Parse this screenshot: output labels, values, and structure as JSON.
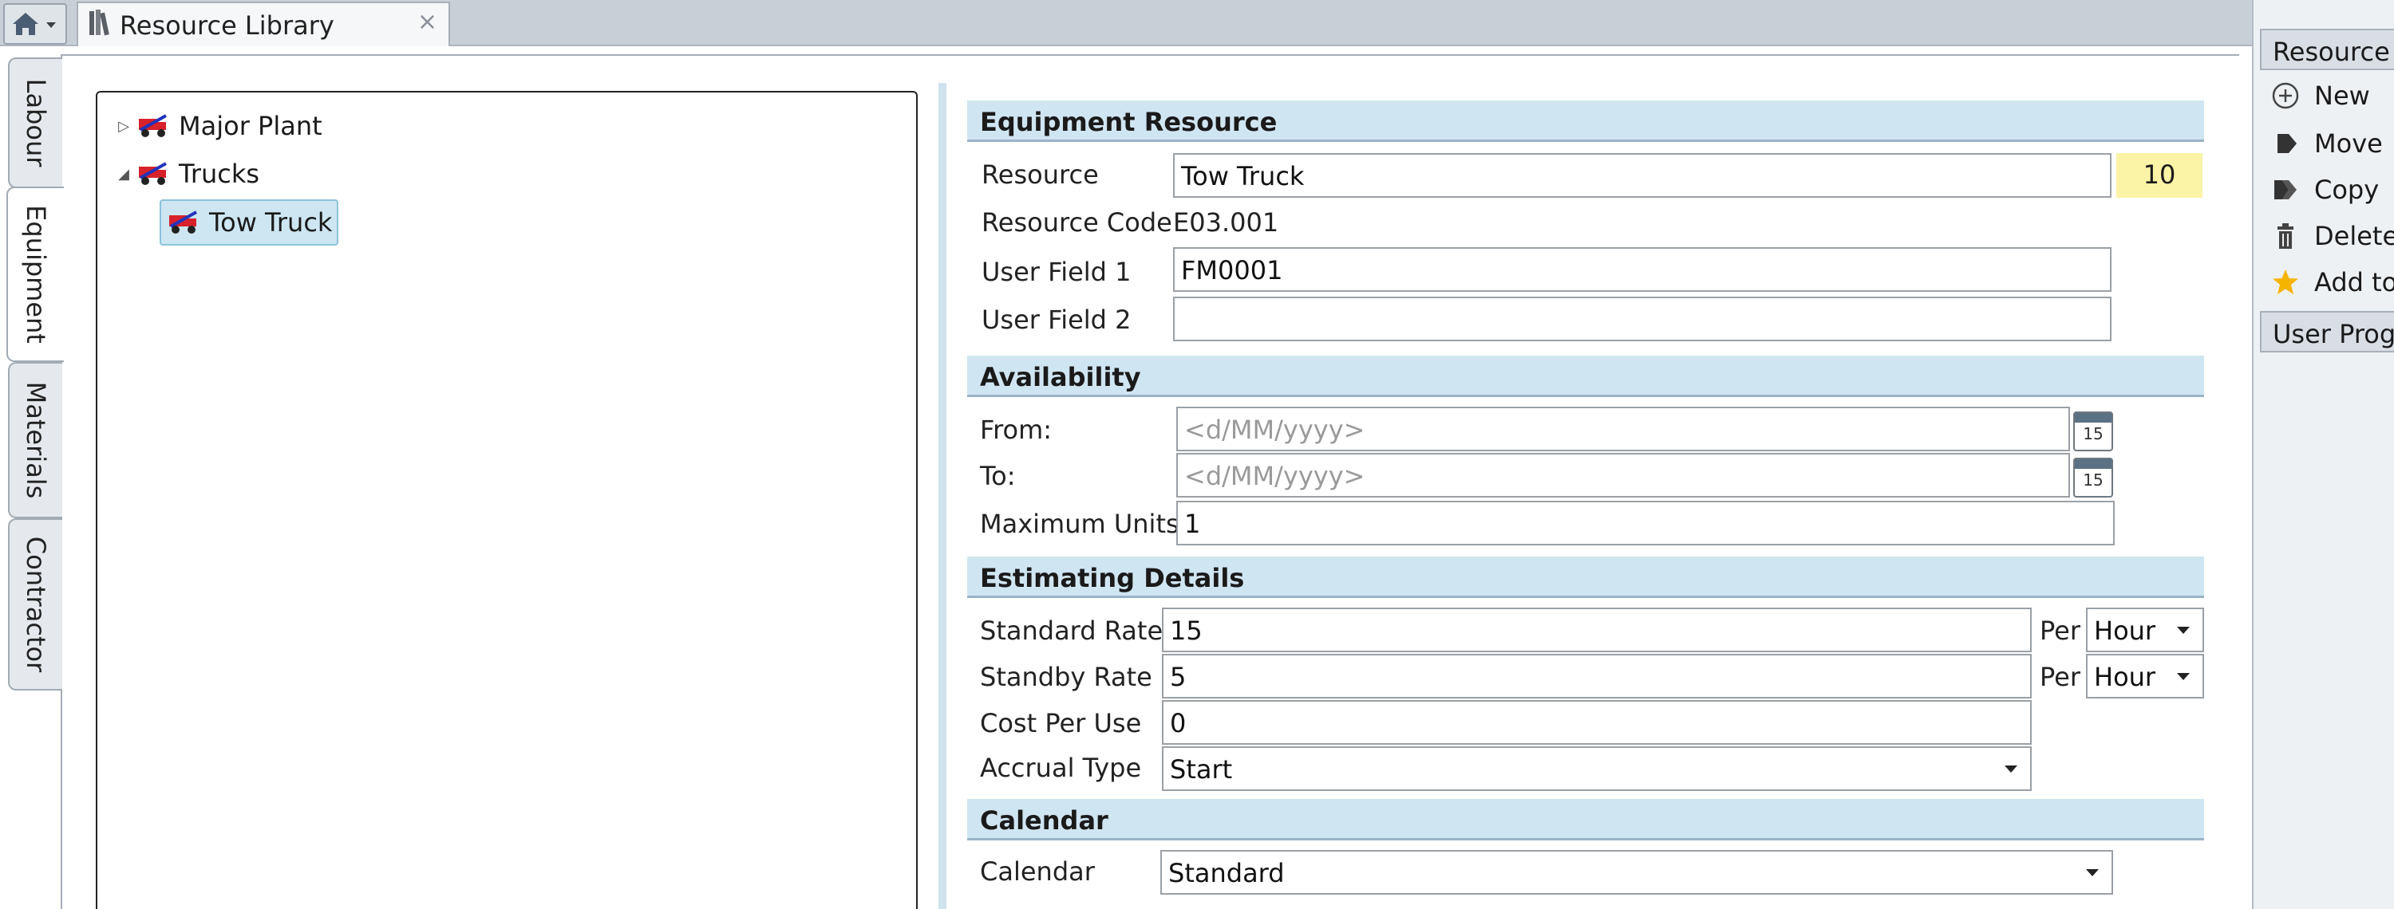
{
  "top_bar": {
    "home_menu_icon": "home-icon",
    "document_tab": {
      "title": "Resource Library",
      "close_glyph": "×"
    }
  },
  "side_tabs": [
    "Labour",
    "Equipment",
    "Materials",
    "Contractor"
  ],
  "active_side_tab": "Equipment",
  "tree": {
    "nodes": [
      {
        "label": "Major Plant",
        "expanded": false,
        "level": 0
      },
      {
        "label": "Trucks",
        "expanded": true,
        "level": 0
      },
      {
        "label": "Tow Truck",
        "selected": true,
        "level": 1
      }
    ]
  },
  "form": {
    "equipment_section": "Equipment Resource",
    "resource_label": "Resource",
    "resource_value": "Tow Truck",
    "resource_badge": "10",
    "resource_code_label": "Resource Code",
    "resource_code_value": "E03.001",
    "user_field_1_label": "User Field 1",
    "user_field_1_value": "FM0001",
    "user_field_2_label": "User Field 2",
    "user_field_2_value": "",
    "availability_section": "Availability",
    "from_label": "From:",
    "from_placeholder": "<d/MM/yyyy>",
    "to_label": "To:",
    "to_placeholder": "<d/MM/yyyy>",
    "calendar_day": "15",
    "max_units_label": "Maximum Units",
    "max_units_value": "1",
    "estimating_section": "Estimating Details",
    "standard_rate_label": "Standard Rate",
    "standard_rate_value": "15",
    "per_label": "Per",
    "standard_rate_unit": "Hour",
    "standby_rate_label": "Standby Rate",
    "standby_rate_value": "5",
    "standby_rate_unit": "Hour",
    "cost_per_use_label": "Cost Per Use",
    "cost_per_use_value": "0",
    "accrual_type_label": "Accrual Type",
    "accrual_type_value": "Start",
    "calendar_section": "Calendar",
    "calendar_label": "Calendar",
    "calendar_value": "Standard"
  },
  "right_panel": {
    "header": "Resource L",
    "items": [
      {
        "label": "New",
        "icon": "plus-circle-icon"
      },
      {
        "label": "Move",
        "icon": "move-arrow-icon"
      },
      {
        "label": "Copy",
        "icon": "copy-arrows-icon"
      },
      {
        "label": "Delete",
        "icon": "trash-icon"
      },
      {
        "label": "Add to",
        "icon": "star-icon"
      }
    ],
    "footer_header": "User Progr"
  },
  "colors": {
    "section_header_bg": "#d0e5f2",
    "badge_bg": "#fbf3a5",
    "selected_node_bg": "#cde6f2",
    "star": "#f5b400"
  }
}
